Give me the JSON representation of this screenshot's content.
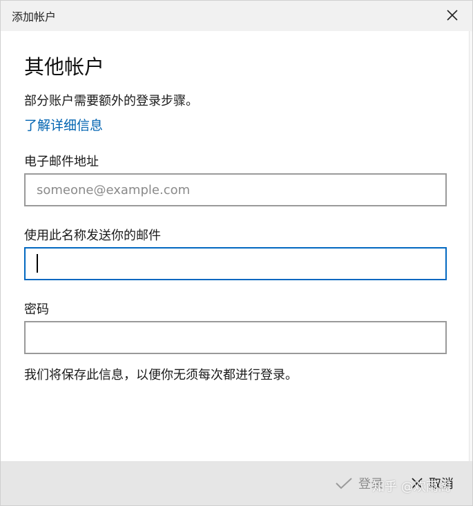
{
  "window": {
    "title": "添加帐户"
  },
  "content": {
    "heading": "其他帐户",
    "description": "部分账户需要额外的登录步骤。",
    "learn_more": "了解详细信息",
    "email": {
      "label": "电子邮件地址",
      "placeholder": "someone@example.com",
      "value": ""
    },
    "sender_name": {
      "label": "使用此名称发送你的邮件",
      "value": ""
    },
    "password": {
      "label": "密码",
      "value": ""
    },
    "note": "我们将保存此信息，以便你无须每次都进行登录。"
  },
  "footer": {
    "signin_label": "登录",
    "cancel_label": "取消"
  },
  "watermark": "知乎 @欢雨阁",
  "colors": {
    "link": "#0063b1",
    "focus_border": "#0067c0",
    "input_border": "#999999",
    "footer_bg": "#e6e6e6",
    "titlebar_bg": "#f1f1f1"
  },
  "icons": {
    "close": "close-icon",
    "signin": "checkmark-icon",
    "cancel": "close-icon"
  }
}
